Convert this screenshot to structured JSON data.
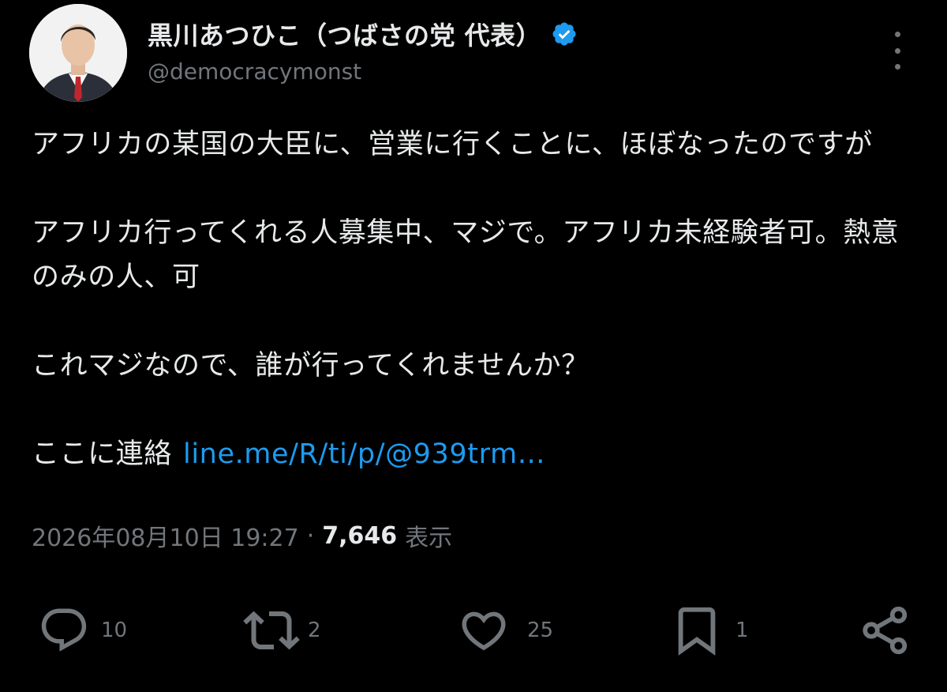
{
  "author": {
    "display_name": "黒川あつひこ（つばさの党 代表）",
    "handle": "@democracymonst",
    "verified": true,
    "avatar_icon": "user-avatar-photo"
  },
  "tweet": {
    "lines": [
      "アフリカの某国の大臣に、営業に行くことに、ほぼなったのですが",
      "アフリカ行ってくれる人募集中、マジで。アフリカ未経験者可。熱意のみの人、可",
      "これマジなので、誰が行ってくれませんか？"
    ],
    "contact_prefix": "ここに連絡",
    "link_text": "line.me/R/ti/p/@939trm…"
  },
  "meta": {
    "timestamp": "2026年08月10日 19:27",
    "separator": "·",
    "views_count": "7,646",
    "views_label": "表示"
  },
  "actions": {
    "reply_count": "10",
    "retweet_count": "2",
    "like_count": "25",
    "bookmark_count": "1"
  },
  "colors": {
    "background": "#000000",
    "text": "#e7e9ea",
    "secondary": "#71767b",
    "link": "#1d9bf0",
    "verified_badge": "#1d9bf0"
  }
}
